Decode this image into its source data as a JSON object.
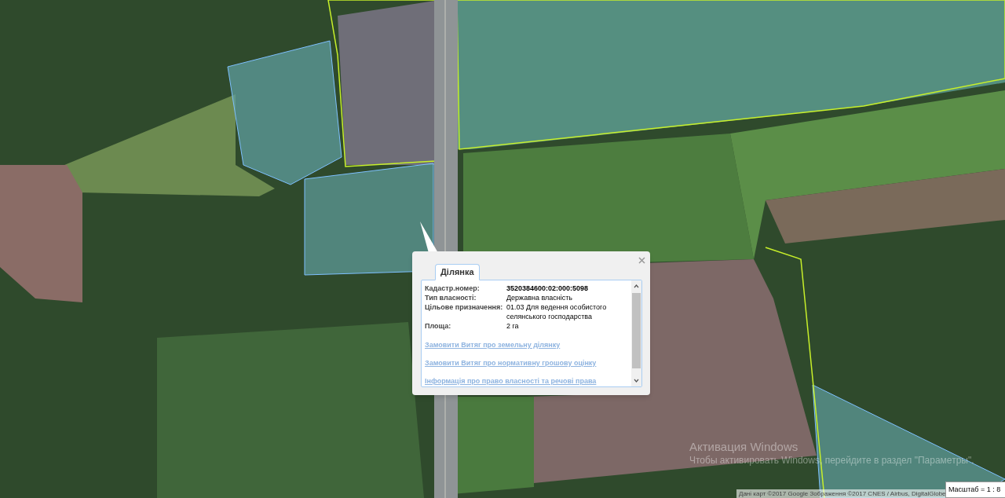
{
  "map": {
    "attribution": "Дані карт ©2017 Google Зображення ©2017 CNES / Airbus, DigitalGlobe",
    "scale": "Масштаб = 1 : 8"
  },
  "popup": {
    "tabs": [
      {
        "label": "Ділянка",
        "selected": true
      }
    ],
    "fields": [
      {
        "label": "Кадастр.номер:",
        "value": "3520384600:02:000:5098",
        "bold": true
      },
      {
        "label": "Тип власності:",
        "value": "Державна власність",
        "bold": false
      },
      {
        "label": "Цільове призначення:",
        "value": "01.03 Для ведення особистого селянського господарства",
        "bold": false
      },
      {
        "label": "Площа:",
        "value": "2 га",
        "bold": false
      }
    ],
    "links": [
      "Замовити Витяг про земельну ділянку",
      "Замовити Витяг про нормативну грошову оцінку",
      "Інформація про право власності та речові права"
    ]
  },
  "os_notice": {
    "title": "Активация Windows",
    "text": "Чтобы активировать Windows, перейдите в раздел \"Параметры\"."
  }
}
